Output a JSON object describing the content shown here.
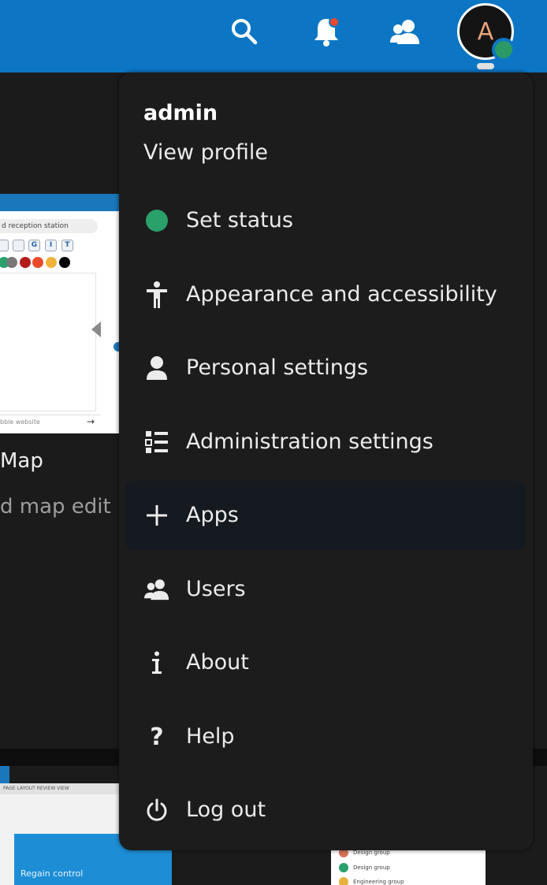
{
  "header": {
    "avatar_initial": "A",
    "icons": [
      "search-icon",
      "notifications-icon",
      "contacts-icon"
    ],
    "accent_color": "#0c76c4",
    "notification_dot_color": "#e9472e",
    "status_color": "#2aa06b"
  },
  "background": {
    "thumbnail_search_text": "d reception station",
    "thumbnail_format_buttons": [
      "",
      "",
      "G",
      "I",
      "T"
    ],
    "thumbnail_footer_text": "bble website",
    "app_title": "Map",
    "app_subtitle": "d map edit",
    "second_thumb_hero_text": "Regain control",
    "second_thumb_ribbon_text": "PAGE LAYOUT   REVIEW   VIEW",
    "second_thumb_rows": [
      "Design group",
      "Design group",
      "Engineering group"
    ]
  },
  "menu": {
    "username": "admin",
    "view_profile": "View profile",
    "items": [
      {
        "label": "Set status",
        "icon": "status-dot-icon"
      },
      {
        "label": "Appearance and accessibility",
        "icon": "accessibility-icon"
      },
      {
        "label": "Personal settings",
        "icon": "user-icon"
      },
      {
        "label": "Administration settings",
        "icon": "list-settings-icon"
      },
      {
        "label": "Apps",
        "icon": "plus-icon",
        "active": true
      },
      {
        "label": "Users",
        "icon": "users-icon"
      },
      {
        "label": "About",
        "icon": "info-icon"
      },
      {
        "label": "Help",
        "icon": "help-icon"
      },
      {
        "label": "Log out",
        "icon": "power-icon"
      }
    ]
  }
}
